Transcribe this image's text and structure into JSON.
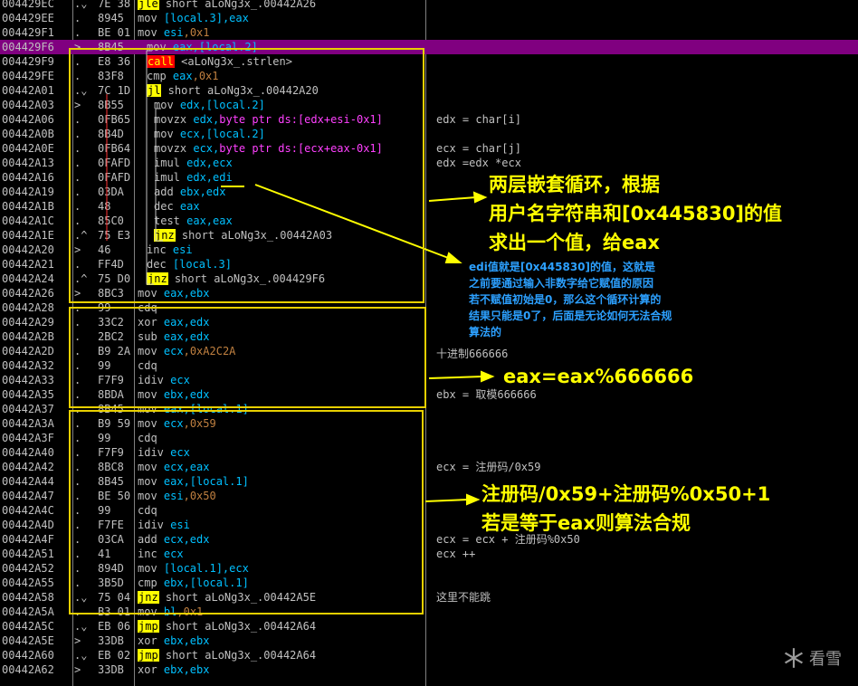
{
  "rows": [
    {
      "addr": "004429EC",
      "mk": ".⌄",
      "hex": "7E 38",
      "mn": "jle",
      "hl": "jmp",
      "ops": [
        {
          "t": " short aLoNg3x_.00442A26",
          "c": "txt"
        }
      ],
      "cmt": ""
    },
    {
      "addr": "004429EE",
      "mk": ".",
      "hex": "8945",
      "mn": "mov",
      "ops": [
        {
          "t": " [local.3]",
          "c": "reg"
        },
        {
          "t": ",eax",
          "c": "reg"
        }
      ],
      "cmt": ""
    },
    {
      "addr": "004429F1",
      "mk": ".",
      "hex": "BE 01",
      "mn": "mov",
      "ops": [
        {
          "t": " esi",
          "c": "reg"
        },
        {
          "t": ",0x1",
          "c": "num"
        }
      ],
      "cmt": ""
    },
    {
      "addr": "004429F6",
      "mk": ">",
      "hex": "8B45",
      "mn": "mov",
      "ops": [
        {
          "t": " eax,[local.2]",
          "c": "reg"
        }
      ],
      "cmt": "",
      "sel": true
    },
    {
      "addr": "004429F9",
      "mk": ".",
      "hex": "E8 36",
      "mn": "call",
      "hl": "call",
      "ops": [
        {
          "t": " <aLoNg3x_.strlen>",
          "c": "txt"
        }
      ],
      "cmt": ""
    },
    {
      "addr": "004429FE",
      "mk": ".",
      "hex": "83F8",
      "mn": "cmp",
      "ops": [
        {
          "t": " eax",
          "c": "reg"
        },
        {
          "t": ",0x1",
          "c": "num"
        }
      ],
      "cmt": ""
    },
    {
      "addr": "00442A01",
      "mk": ".⌄",
      "hex": "7C 1D",
      "mn": "jl",
      "hl": "jmp",
      "ops": [
        {
          "t": " short aLoNg3x_.00442A20",
          "c": "txt"
        }
      ],
      "cmt": ""
    },
    {
      "addr": "00442A03",
      "mk": ">",
      "hex": "8B55",
      "mn": "mov",
      "ops": [
        {
          "t": " edx,[local.2]",
          "c": "reg"
        }
      ],
      "cmt": ""
    },
    {
      "addr": "00442A06",
      "mk": ".",
      "hex": "0FB65",
      "mn": "movzx",
      "ops": [
        {
          "t": " edx,",
          "c": "reg"
        },
        {
          "t": "byte ptr ds:[edx+esi-0x1]",
          "c": "mem"
        }
      ],
      "cmt": "edx = char[i]"
    },
    {
      "addr": "00442A0B",
      "mk": ".",
      "hex": "8B4D",
      "mn": "mov",
      "ops": [
        {
          "t": " ecx,[local.2]",
          "c": "reg"
        }
      ],
      "cmt": ""
    },
    {
      "addr": "00442A0E",
      "mk": ".",
      "hex": "0FB64",
      "mn": "movzx",
      "ops": [
        {
          "t": " ecx,",
          "c": "reg"
        },
        {
          "t": "byte ptr ds:[ecx+eax-0x1]",
          "c": "mem"
        }
      ],
      "cmt": "ecx = char[j]"
    },
    {
      "addr": "00442A13",
      "mk": ".",
      "hex": "0FAFD",
      "mn": "imul",
      "ops": [
        {
          "t": " edx,ecx",
          "c": "reg"
        }
      ],
      "cmt": "edx =edx *ecx"
    },
    {
      "addr": "00442A16",
      "mk": ".",
      "hex": "0FAFD",
      "mn": "imul",
      "ops": [
        {
          "t": " edx,edi",
          "c": "reg"
        }
      ],
      "cmt": ""
    },
    {
      "addr": "00442A19",
      "mk": ".",
      "hex": "03DA",
      "mn": "add",
      "ops": [
        {
          "t": " ebx,edx",
          "c": "reg"
        }
      ],
      "cmt": ""
    },
    {
      "addr": "00442A1B",
      "mk": ".",
      "hex": "48",
      "mn": "dec",
      "ops": [
        {
          "t": " eax",
          "c": "reg"
        }
      ],
      "cmt": ""
    },
    {
      "addr": "00442A1C",
      "mk": ".",
      "hex": "85C0",
      "mn": "test",
      "ops": [
        {
          "t": " eax,eax",
          "c": "reg"
        }
      ],
      "cmt": ""
    },
    {
      "addr": "00442A1E",
      "mk": ".^",
      "hex": "75 E3",
      "mn": "jnz",
      "hl": "jmp",
      "ops": [
        {
          "t": " short aLoNg3x_.00442A03",
          "c": "txt"
        }
      ],
      "cmt": ""
    },
    {
      "addr": "00442A20",
      "mk": ">",
      "hex": "46",
      "mn": "inc",
      "ops": [
        {
          "t": " esi",
          "c": "reg"
        }
      ],
      "cmt": ""
    },
    {
      "addr": "00442A21",
      "mk": ".",
      "hex": "FF4D",
      "mn": "dec",
      "ops": [
        {
          "t": " [local.3]",
          "c": "reg"
        }
      ],
      "cmt": ""
    },
    {
      "addr": "00442A24",
      "mk": ".^",
      "hex": "75 D0",
      "mn": "jnz",
      "hl": "jmp",
      "ops": [
        {
          "t": " short aLoNg3x_.004429F6",
          "c": "txt"
        }
      ],
      "cmt": ""
    },
    {
      "addr": "00442A26",
      "mk": ">",
      "hex": "8BC3",
      "mn": "mov",
      "ops": [
        {
          "t": " eax,ebx",
          "c": "reg"
        }
      ],
      "cmt": ""
    },
    {
      "addr": "00442A28",
      "mk": ".",
      "hex": "99",
      "mn": "cdq",
      "ops": [],
      "cmt": ""
    },
    {
      "addr": "00442A29",
      "mk": ".",
      "hex": "33C2",
      "mn": "xor",
      "ops": [
        {
          "t": " eax,edx",
          "c": "reg"
        }
      ],
      "cmt": ""
    },
    {
      "addr": "00442A2B",
      "mk": ".",
      "hex": "2BC2",
      "mn": "sub",
      "ops": [
        {
          "t": " eax,edx",
          "c": "reg"
        }
      ],
      "cmt": ""
    },
    {
      "addr": "00442A2D",
      "mk": ".",
      "hex": "B9 2A",
      "mn": "mov",
      "ops": [
        {
          "t": " ecx",
          "c": "reg"
        },
        {
          "t": ",0xA2C2A",
          "c": "num"
        }
      ],
      "cmt": ""
    },
    {
      "addr": "00442A32",
      "mk": ".",
      "hex": "99",
      "mn": "cdq",
      "ops": [],
      "cmt": ""
    },
    {
      "addr": "00442A33",
      "mk": ".",
      "hex": "F7F9",
      "mn": "idiv",
      "ops": [
        {
          "t": " ecx",
          "c": "reg"
        }
      ],
      "cmt": ""
    },
    {
      "addr": "00442A35",
      "mk": ".",
      "hex": "8BDA",
      "mn": "mov",
      "ops": [
        {
          "t": " ebx,edx",
          "c": "reg"
        }
      ],
      "cmt": "ebx = 取模666666"
    },
    {
      "addr": "00442A37",
      "mk": ".",
      "hex": "8B45",
      "mn": "mov",
      "ops": [
        {
          "t": " eax,[local.1]",
          "c": "reg"
        }
      ],
      "cmt": ""
    },
    {
      "addr": "00442A3A",
      "mk": ".",
      "hex": "B9 59",
      "mn": "mov",
      "ops": [
        {
          "t": " ecx",
          "c": "reg"
        },
        {
          "t": ",0x59",
          "c": "num"
        }
      ],
      "cmt": ""
    },
    {
      "addr": "00442A3F",
      "mk": ".",
      "hex": "99",
      "mn": "cdq",
      "ops": [],
      "cmt": ""
    },
    {
      "addr": "00442A40",
      "mk": ".",
      "hex": "F7F9",
      "mn": "idiv",
      "ops": [
        {
          "t": " ecx",
          "c": "reg"
        }
      ],
      "cmt": ""
    },
    {
      "addr": "00442A42",
      "mk": ".",
      "hex": "8BC8",
      "mn": "mov",
      "ops": [
        {
          "t": " ecx,eax",
          "c": "reg"
        }
      ],
      "cmt": "ecx = 注册码/0x59"
    },
    {
      "addr": "00442A44",
      "mk": ".",
      "hex": "8B45",
      "mn": "mov",
      "ops": [
        {
          "t": " eax,[local.1]",
          "c": "reg"
        }
      ],
      "cmt": ""
    },
    {
      "addr": "00442A47",
      "mk": ".",
      "hex": "BE 50",
      "mn": "mov",
      "ops": [
        {
          "t": " esi",
          "c": "reg"
        },
        {
          "t": ",0x50",
          "c": "num"
        }
      ],
      "cmt": ""
    },
    {
      "addr": "00442A4C",
      "mk": ".",
      "hex": "99",
      "mn": "cdq",
      "ops": [],
      "cmt": ""
    },
    {
      "addr": "00442A4D",
      "mk": ".",
      "hex": "F7FE",
      "mn": "idiv",
      "ops": [
        {
          "t": " esi",
          "c": "reg"
        }
      ],
      "cmt": ""
    },
    {
      "addr": "00442A4F",
      "mk": ".",
      "hex": "03CA",
      "mn": "add",
      "ops": [
        {
          "t": " ecx,edx",
          "c": "reg"
        }
      ],
      "cmt": "ecx = ecx + 注册码%0x50"
    },
    {
      "addr": "00442A51",
      "mk": ".",
      "hex": "41",
      "mn": "inc",
      "ops": [
        {
          "t": " ecx",
          "c": "reg"
        }
      ],
      "cmt": "ecx ++"
    },
    {
      "addr": "00442A52",
      "mk": ".",
      "hex": "894D",
      "mn": "mov",
      "ops": [
        {
          "t": " [local.1],ecx",
          "c": "reg"
        }
      ],
      "cmt": ""
    },
    {
      "addr": "00442A55",
      "mk": ".",
      "hex": "3B5D",
      "mn": "cmp",
      "ops": [
        {
          "t": " ebx,[local.1]",
          "c": "reg"
        }
      ],
      "cmt": ""
    },
    {
      "addr": "00442A58",
      "mk": ".⌄",
      "hex": "75 04",
      "mn": "jnz",
      "hl": "jmp",
      "ops": [
        {
          "t": " short aLoNg3x_.00442A5E",
          "c": "txt"
        }
      ],
      "cmt": "这里不能跳"
    },
    {
      "addr": "00442A5A",
      "mk": ".",
      "hex": "B3 01",
      "mn": "mov",
      "ops": [
        {
          "t": " bl",
          "c": "reg"
        },
        {
          "t": ",0x1",
          "c": "num"
        }
      ],
      "cmt": ""
    },
    {
      "addr": "00442A5C",
      "mk": ".⌄",
      "hex": "EB 06",
      "mn": "jmp",
      "hl": "jmp",
      "ops": [
        {
          "t": " short aLoNg3x_.00442A64",
          "c": "txt"
        }
      ],
      "cmt": ""
    },
    {
      "addr": "00442A5E",
      "mk": ">",
      "hex": "33DB",
      "mn": "xor",
      "ops": [
        {
          "t": " ebx,ebx",
          "c": "reg"
        }
      ],
      "cmt": ""
    },
    {
      "addr": "00442A60",
      "mk": ".⌄",
      "hex": "EB 02",
      "mn": "jmp",
      "hl": "jmp",
      "ops": [
        {
          "t": " short aLoNg3x_.00442A64",
          "c": "txt"
        }
      ],
      "cmt": ""
    },
    {
      "addr": "00442A62",
      "mk": ">",
      "hex": "33DB",
      "mn": "xor",
      "ops": [
        {
          "t": " ebx,ebx",
          "c": "reg"
        }
      ],
      "cmt": ""
    }
  ],
  "annotations": {
    "loop_note": "两层嵌套循环，根据\n用户名字符串和[0x445830]的值\n求出一个值，给eax",
    "edi_note": "edi值就是[0x445830]的值，这就是\n之前要通过输入非数字给它赋值的原因\n若不赋值初始是0，那么这个循环计算的\n结果只能是0了，后面是无论如何无法合规\n算法的",
    "decimal_note": "十进制666666",
    "mod_note": "eax=eax%666666",
    "check_note": "注册码/0x59+注册码%0x50+1\n若是等于eax则算法合规"
  },
  "watermark": "看雪",
  "colors": {
    "background": "#000000",
    "selection": "#800080",
    "register": "#00c0ff",
    "memory": "#ff40ff",
    "immediate": "#c08040",
    "highlight_box": "#e8d000",
    "note_yellow": "#ffff00",
    "note_blue": "#2ca0ff",
    "call_bg": "#ff0000",
    "jump_bg": "#ffff00"
  }
}
